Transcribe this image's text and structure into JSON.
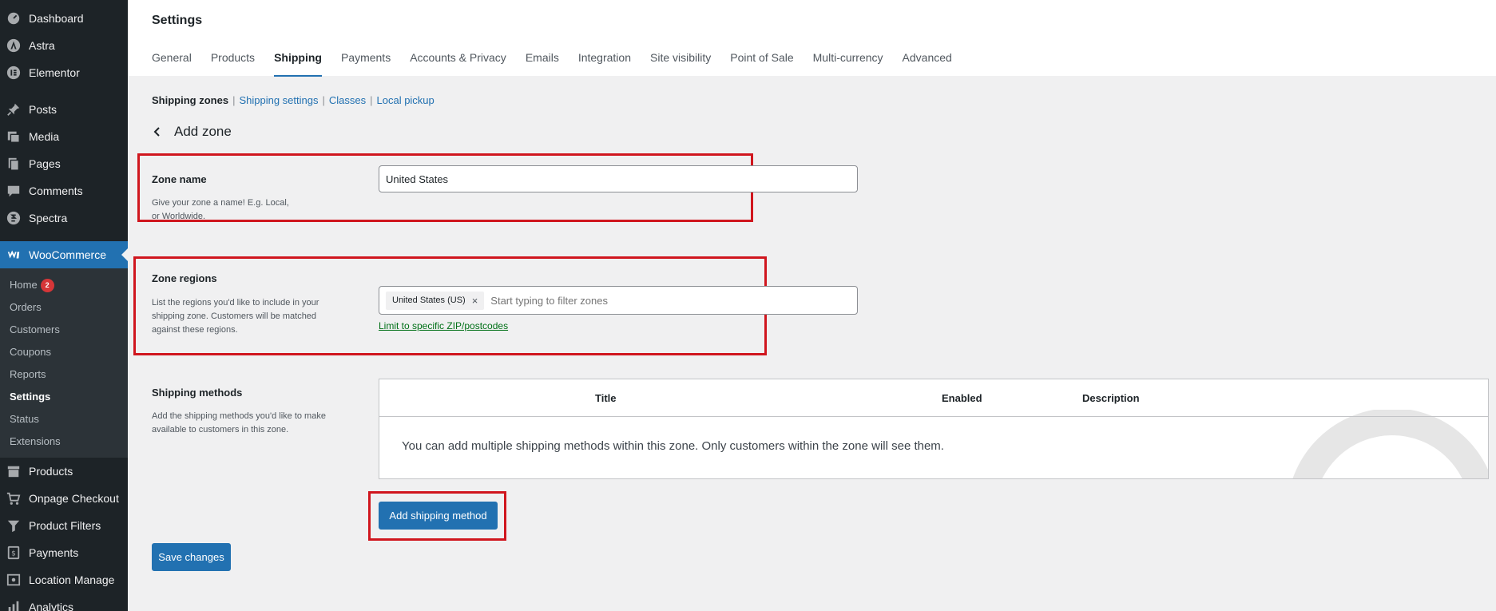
{
  "sidebar": {
    "top_items": [
      {
        "label": "Dashboard",
        "icon": "dashboard-icon"
      },
      {
        "label": "Astra",
        "icon": "astra-icon"
      },
      {
        "label": "Elementor",
        "icon": "elementor-icon"
      }
    ],
    "content_items": [
      {
        "label": "Posts",
        "icon": "pin-icon"
      },
      {
        "label": "Media",
        "icon": "media-icon"
      },
      {
        "label": "Pages",
        "icon": "pages-icon"
      },
      {
        "label": "Comments",
        "icon": "comment-icon"
      },
      {
        "label": "Spectra",
        "icon": "spectra-icon"
      }
    ],
    "woocommerce": {
      "label": "WooCommerce",
      "icon": "woocommerce-icon"
    },
    "submenu": [
      {
        "label": "Home",
        "badge": "2"
      },
      {
        "label": "Orders"
      },
      {
        "label": "Customers"
      },
      {
        "label": "Coupons"
      },
      {
        "label": "Reports"
      },
      {
        "label": "Settings",
        "current": true
      },
      {
        "label": "Status"
      },
      {
        "label": "Extensions"
      }
    ],
    "bottom_items": [
      {
        "label": "Products",
        "icon": "products-icon"
      },
      {
        "label": "Onpage Checkout",
        "icon": "cart-icon"
      },
      {
        "label": "Product Filters",
        "icon": "filter-icon"
      },
      {
        "label": "Payments",
        "icon": "payments-icon"
      },
      {
        "label": "Location Manage",
        "icon": "location-icon"
      },
      {
        "label": "Analytics",
        "icon": "analytics-icon"
      }
    ]
  },
  "header": {
    "title": "Settings",
    "tabs": [
      "General",
      "Products",
      "Shipping",
      "Payments",
      "Accounts & Privacy",
      "Emails",
      "Integration",
      "Site visibility",
      "Point of Sale",
      "Multi-currency",
      "Advanced"
    ],
    "active_tab": "Shipping"
  },
  "subnav": {
    "current": "Shipping zones",
    "links": [
      "Shipping settings",
      "Classes",
      "Local pickup"
    ],
    "separator": "|"
  },
  "zone": {
    "title": "Add zone",
    "name_label": "Zone name",
    "name_desc_line1": "Give your zone a name! E.g. Local,",
    "name_desc_line2": "or Worldwide.",
    "name_value": "United States",
    "regions_label": "Zone regions",
    "regions_desc_line1": "List the regions you'd like to include in your",
    "regions_desc_line2": "shipping zone. Customers will be matched",
    "regions_desc_line3": "against these regions.",
    "region_token": "United States (US)",
    "regions_placeholder": "Start typing to filter zones",
    "zip_link": "Limit to specific ZIP/postcodes"
  },
  "methods": {
    "label": "Shipping methods",
    "desc_line1": "Add the shipping methods you'd like to make",
    "desc_line2": "available to customers in this zone.",
    "columns": [
      "Title",
      "Enabled",
      "Description"
    ],
    "empty_message": "You can add multiple shipping methods within this zone. Only customers within the zone will see them.",
    "add_button": "Add shipping method"
  },
  "save_button": "Save changes",
  "colors": {
    "sidebar_bg": "#1d2327",
    "accent": "#2271b1",
    "highlight": "#d0161e",
    "link_green": "#007017",
    "badge": "#d63638"
  }
}
